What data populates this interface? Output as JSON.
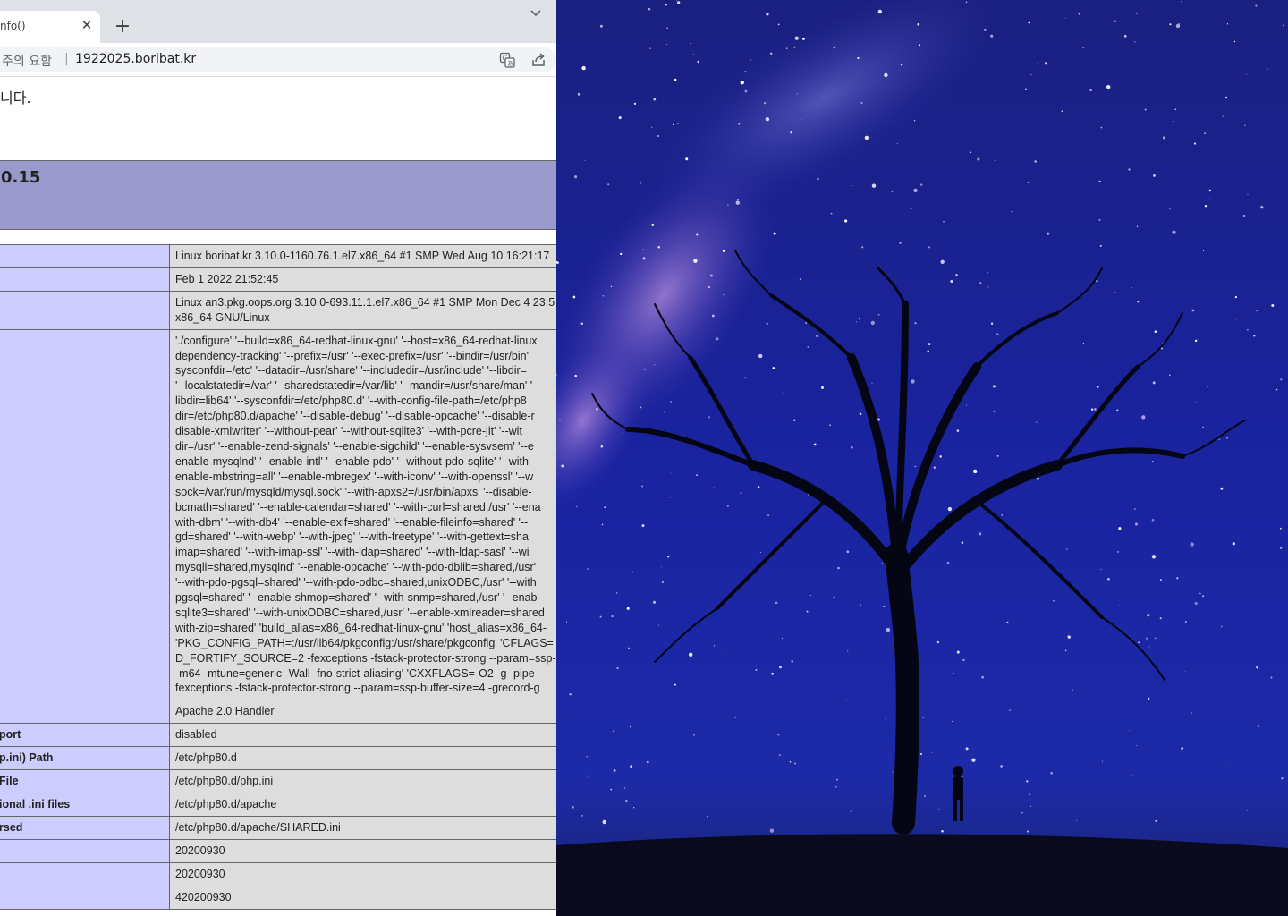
{
  "browser": {
    "tab": {
      "title": "nfo()",
      "close_glyph": "✕"
    },
    "new_tab_glyph": "+",
    "address": {
      "security_label": "주의 요함",
      "separator": "|",
      "url": "1922025.boribat.kr"
    },
    "icons": {
      "translate": "translate-icon",
      "share": "share-icon",
      "tab-list": "chevron-down-icon"
    }
  },
  "page": {
    "notice": "니다.",
    "php_header": {
      "version": "0.15"
    },
    "rows": [
      {
        "key": "",
        "value": [
          "Linux boribat.kr 3.10.0-1160.76.1.el7.x86_64 #1 SMP Wed Aug 10 16:21:17"
        ]
      },
      {
        "key": "",
        "value": [
          "Feb 1 2022 21:52:45"
        ]
      },
      {
        "key": "",
        "value": [
          "Linux an3.pkg.oops.org 3.10.0-693.11.1.el7.x86_64 #1 SMP Mon Dec 4 23:5",
          "x86_64 GNU/Linux"
        ]
      },
      {
        "key": "",
        "value": [
          "'./configure' '--build=x86_64-redhat-linux-gnu' '--host=x86_64-redhat-linux",
          "dependency-tracking' '--prefix=/usr' '--exec-prefix=/usr' '--bindir=/usr/bin'",
          "sysconfdir=/etc' '--datadir=/usr/share' '--includedir=/usr/include' '--libdir=",
          "'--localstatedir=/var' '--sharedstatedir=/var/lib' '--mandir=/usr/share/man' '",
          "libdir=lib64' '--sysconfdir=/etc/php80.d' '--with-config-file-path=/etc/php8",
          "dir=/etc/php80.d/apache' '--disable-debug' '--disable-opcache' '--disable-r",
          "disable-xmlwriter' '--without-pear' '--without-sqlite3' '--with-pcre-jit' '--wit",
          "dir=/usr' '--enable-zend-signals' '--enable-sigchild' '--enable-sysvsem' '--e",
          "enable-mysqlnd' '--enable-intl' '--enable-pdo' '--without-pdo-sqlite' '--with",
          "enable-mbstring=all' '--enable-mbregex' '--with-iconv' '--with-openssl' '--w",
          "sock=/var/run/mysqld/mysql.sock' '--with-apxs2=/usr/bin/apxs' '--disable-",
          "bcmath=shared' '--enable-calendar=shared' '--with-curl=shared,/usr' '--ena",
          "with-dbm' '--with-db4' '--enable-exif=shared' '--enable-fileinfo=shared' '--",
          "gd=shared' '--with-webp' '--with-jpeg' '--with-freetype' '--with-gettext=sha",
          "imap=shared' '--with-imap-ssl' '--with-ldap=shared' '--with-ldap-sasl' '--wi",
          "mysqli=shared,mysqlnd' '--enable-opcache' '--with-pdo-dblib=shared,/usr'",
          "'--with-pdo-pgsql=shared' '--with-pdo-odbc=shared,unixODBC,/usr' '--with",
          "pgsql=shared' '--enable-shmop=shared' '--with-snmp=shared,/usr' '--enab",
          "sqlite3=shared' '--with-unixODBC=shared,/usr' '--enable-xmlreader=shared",
          "with-zip=shared' 'build_alias=x86_64-redhat-linux-gnu' 'host_alias=x86_64-",
          "'PKG_CONFIG_PATH=:/usr/lib64/pkgconfig:/usr/share/pkgconfig' 'CFLAGS=",
          "D_FORTIFY_SOURCE=2 -fexceptions -fstack-protector-strong --param=ssp-",
          "-m64 -mtune=generic -Wall -fno-strict-aliasing' 'CXXFLAGS=-O2 -g -pipe",
          "fexceptions -fstack-protector-strong --param=ssp-buffer-size=4 -grecord-g"
        ]
      },
      {
        "key": "",
        "value": [
          "Apache 2.0 Handler"
        ]
      },
      {
        "key": "port",
        "value": [
          "disabled"
        ]
      },
      {
        "key": "p.ini) Path",
        "value": [
          "/etc/php80.d"
        ]
      },
      {
        "key": " File",
        "value": [
          "/etc/php80.d/php.ini"
        ]
      },
      {
        "key": "ional .ini files",
        "value": [
          "/etc/php80.d/apache"
        ]
      },
      {
        "key": "rsed",
        "value": [
          "/etc/php80.d/apache/SHARED.ini"
        ]
      },
      {
        "key": "",
        "value": [
          "20200930"
        ]
      },
      {
        "key": "",
        "value": [
          "20200930"
        ]
      },
      {
        "key": "",
        "value": [
          "420200930"
        ]
      }
    ]
  },
  "wallpaper": {
    "description_icon": "night-sky-tree-wallpaper"
  }
}
